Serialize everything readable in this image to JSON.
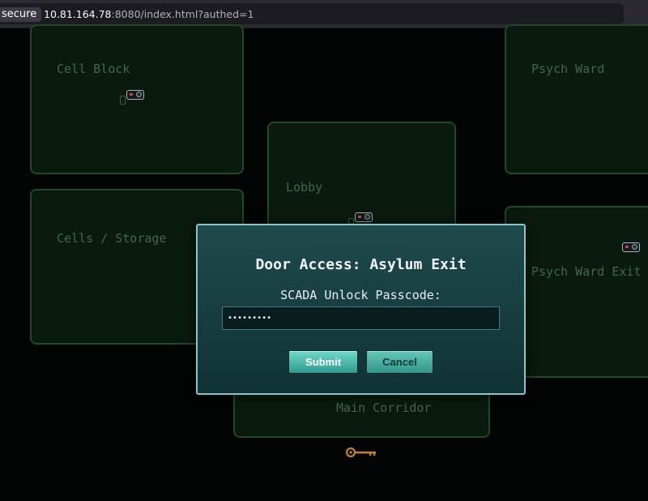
{
  "browser": {
    "secure_label": "secure",
    "url_host": "10.81.164.78",
    "url_rest": ":8080/index.html?authed=1"
  },
  "map": {
    "rooms": [
      {
        "label": "Cell Block"
      },
      {
        "label": "Psych Ward"
      },
      {
        "label": "Lobby"
      },
      {
        "label": "Cells / Storage"
      },
      {
        "label": "Psych Ward Exit"
      },
      {
        "label": "Main Corridor"
      }
    ]
  },
  "modal": {
    "title": "Door Access: Asylum Exit",
    "prompt": "SCADA Unlock Passcode:",
    "password_value": "•••••••••",
    "submit_label": "Submit",
    "cancel_label": "Cancel"
  },
  "colors": {
    "room_fill": "#0b1a0e",
    "room_border": "#1f4a27",
    "room_label": "#3d6a48",
    "modal_bg": "#1f4a4c",
    "modal_border": "#7fc9c9",
    "button_teal": "#4fbcae",
    "key_gold": "#c28a00"
  }
}
